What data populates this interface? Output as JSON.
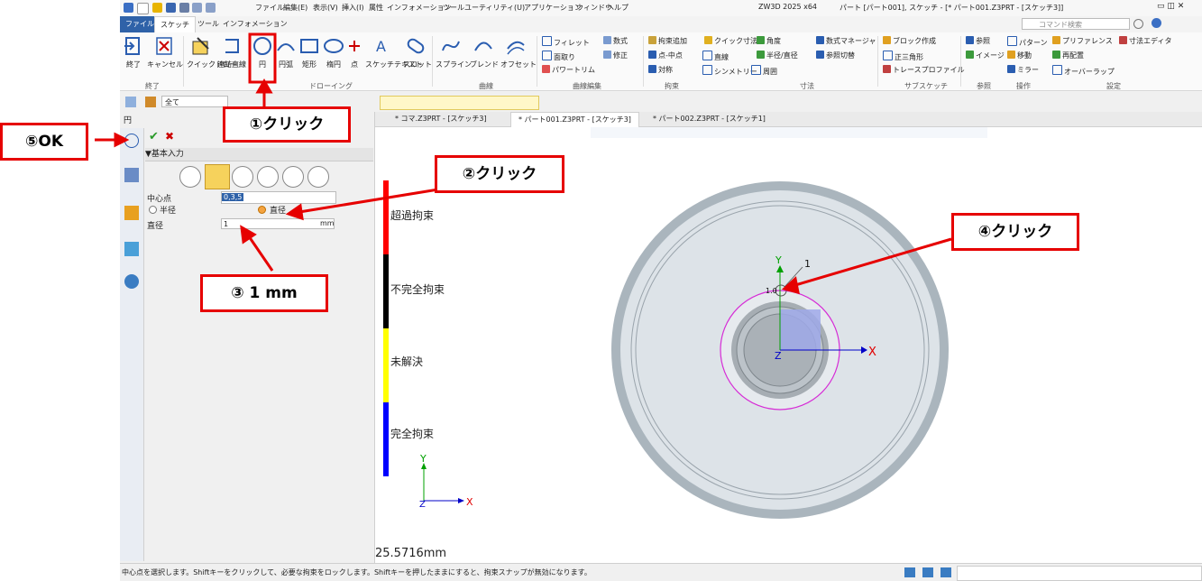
{
  "title_bar": {
    "quick_menus": [
      "ファイル",
      "編集(E)",
      "表示(V)",
      "挿入(I)",
      "属性",
      "インフォメーション",
      "ツール",
      "ユーティリティ(U)",
      "アプリケーション",
      "ウィンドウ",
      "ヘルプ"
    ],
    "app_version": "ZW3D 2025 x64",
    "document_title": "パート [パート001], スケッチ - [* パート001.Z3PRT - [スケッチ3]]"
  },
  "tabs": [
    "ファイル(F)",
    "スケッチ",
    "ツール",
    "インフォメーション"
  ],
  "search_placeholder": "コマンド検索",
  "ribbon": {
    "end_group": {
      "label": "終了",
      "buttons": [
        "終了",
        "キャンセル"
      ]
    },
    "drawing_group": {
      "label": "ドローイング",
      "buttons": [
        "クイックドロー",
        "連結直線",
        "円",
        "円弧",
        "矩形",
        "楕円",
        "点",
        "スケッチテキスト",
        "スロット"
      ]
    },
    "curve_group": {
      "label": "曲線",
      "buttons": [
        "スプライン",
        "ブレンド",
        "オフセット"
      ]
    },
    "curve_edit_group": {
      "label": "曲線編集",
      "items": [
        "フィレット",
        "面取り",
        "パワートリム",
        "数式",
        "修正"
      ]
    },
    "constraint_group": {
      "label": "拘束",
      "items": [
        "拘束追加",
        "点-中点",
        "対称",
        "直線",
        "シンメトリー",
        "周囲"
      ]
    },
    "dimension_group": {
      "label": "寸法",
      "items": [
        "クイック寸法",
        "角度",
        "半径/直径",
        "数式マネージャ",
        "参照切替"
      ]
    },
    "subsketch_group": {
      "label": "サブスケッチ",
      "items": [
        "ブロック作成",
        "正三角形",
        "トレースプロファイル"
      ]
    },
    "reference_group": {
      "label": "参照",
      "items": [
        "参照",
        "イメージ"
      ]
    },
    "operation_group": {
      "label": "操作",
      "items": [
        "パターン",
        "移動",
        "ミラー"
      ]
    },
    "settings_group": {
      "label": "設定",
      "items": [
        "プリファレンス",
        "再配置",
        "オーバーラップ",
        "寸法エディタ"
      ]
    }
  },
  "filter_value": "全て",
  "panel": {
    "title": "円",
    "section": "▼基本入力",
    "center_label": "中心点",
    "center_value": "0,3,5",
    "radius_label": "半径",
    "diameter_label": "直径",
    "diameter_field_label": "直径",
    "diameter_value": "1",
    "unit": "mm"
  },
  "doc_tabs": [
    "* コマ.Z3PRT - [スケッチ3]",
    "* パート001.Z3PRT - [スケッチ3]",
    "* パート002.Z3PRT - [スケッチ1]"
  ],
  "legend": [
    {
      "label": "超過拘束",
      "color": "#ff0000"
    },
    {
      "label": "不完全拘束",
      "color": "#000000"
    },
    {
      "label": "未解決",
      "color": "#ffff00"
    },
    {
      "label": "完全拘束",
      "color": "#0000ff"
    }
  ],
  "measurement": "25.5716mm",
  "canvas": {
    "axis_x": "X",
    "axis_y": "Y",
    "axis_z": "Z",
    "dim_label": "1",
    "dim_value": "1.0"
  },
  "status_text": "中心点を選択します。Shiftキーをクリックして、必要な拘束をロックします。Shiftキーを押したままにすると、拘束スナップが無効になります。",
  "callouts": {
    "c1": "①クリック",
    "c2": "②クリック",
    "c3": "③ 1 mm",
    "c4": "④クリック",
    "c5": "⑤OK"
  }
}
